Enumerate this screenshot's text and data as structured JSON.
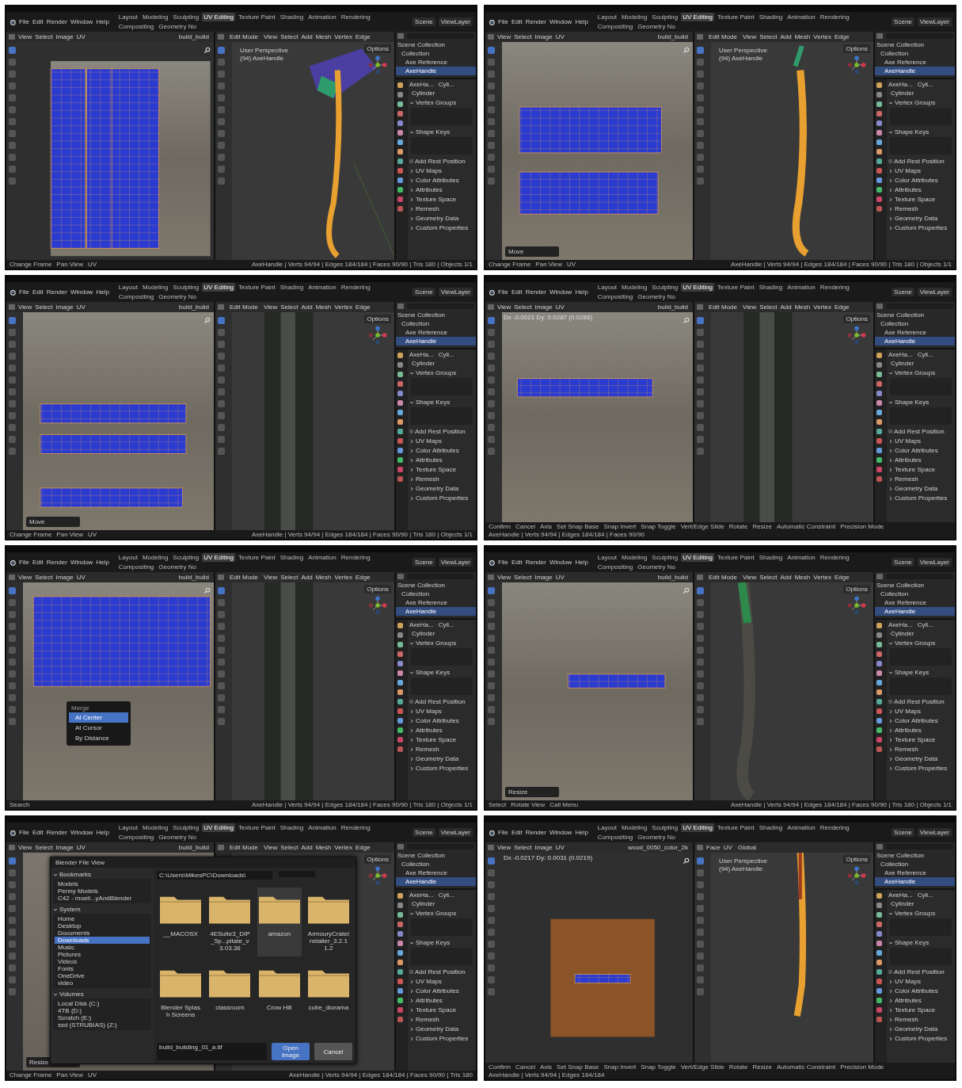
{
  "panels": [
    {
      "menus": [
        "File",
        "Edit",
        "Render",
        "Window",
        "Help"
      ],
      "workspaces": [
        {
          "label": "Layout",
          "selected": false
        },
        {
          "label": "Modeling",
          "selected": false
        },
        {
          "label": "Sculpting",
          "selected": false
        },
        {
          "label": "UV Editing",
          "selected": true
        },
        {
          "label": "Texture Paint",
          "selected": false
        },
        {
          "label": "Shading",
          "selected": false
        },
        {
          "label": "Animation",
          "selected": false
        },
        {
          "label": "Rendering",
          "selected": false
        },
        {
          "label": "Compositing",
          "selected": false
        },
        {
          "label": "Geometry No",
          "selected": false
        }
      ],
      "scene": "Scene",
      "view_layer": "ViewLayer",
      "uv_editor": {
        "menus": [
          "View",
          "Select",
          "Image",
          "UV"
        ],
        "image": "build_build",
        "kind": "vertical"
      },
      "viewport": {
        "mode": "Edit Mode",
        "menus": [
          "View",
          "Select",
          "Add",
          "Mesh",
          "Vertex",
          "Edge"
        ],
        "options": "Options",
        "overlay": [
          "User Perspective",
          "(94) AxeHandle"
        ],
        "kind": "axe"
      },
      "outliner": [
        {
          "label": "Scene Collection",
          "selected": false,
          "children": [
            {
              "label": "Collection",
              "selected": false,
              "children": [
                {
                  "label": "Axe Reference",
                  "selected": false
                },
                {
                  "label": "AxeHandle",
                  "selected": true
                }
              ]
            }
          ]
        }
      ],
      "properties": {
        "object": "AxeHa...",
        "mesh": "Cyli...",
        "data_name": "Cylinder",
        "sections": [
          {
            "kind": "panel",
            "label": "Vertex Groups",
            "expanded": true
          },
          {
            "kind": "panel",
            "label": "Shape Keys",
            "expanded": true
          },
          {
            "kind": "checkbox",
            "label": "Add Rest Position",
            "checked": false
          },
          {
            "kind": "panel",
            "label": "UV Maps",
            "expanded": false
          },
          {
            "kind": "panel",
            "label": "Color Attributes",
            "expanded": false
          },
          {
            "kind": "panel",
            "label": "Attributes",
            "expanded": false
          },
          {
            "kind": "panel",
            "label": "Texture Space",
            "expanded": false
          },
          {
            "kind": "panel",
            "label": "Remesh",
            "expanded": false
          },
          {
            "kind": "panel",
            "label": "Geometry Data",
            "expanded": false
          },
          {
            "kind": "panel",
            "label": "Custom Properties",
            "expanded": false
          }
        ]
      },
      "status": {
        "hints": [
          "Change Frame",
          "Pan View",
          "UV"
        ],
        "stats": "AxeHandle | Verts 94/94 | Edges 184/184 | Faces 90/90 | Tris 180 | Objects 1/1"
      }
    },
    {
      "menus": [
        "File",
        "Edit",
        "Render",
        "Window",
        "Help"
      ],
      "workspaces": [
        {
          "label": "Layout",
          "selected": false
        },
        {
          "label": "Modeling",
          "selected": false
        },
        {
          "label": "Sculpting",
          "selected": false
        },
        {
          "label": "UV Editing",
          "selected": true
        },
        {
          "label": "Texture Paint",
          "selected": false
        },
        {
          "label": "Shading",
          "selected": false
        },
        {
          "label": "Animation",
          "selected": false
        },
        {
          "label": "Rendering",
          "selected": false
        },
        {
          "label": "Compositing",
          "selected": false
        },
        {
          "label": "Geometry No",
          "selected": false
        }
      ],
      "scene": "Scene",
      "view_layer": "ViewLayer",
      "uv_editor": {
        "menus": [
          "View",
          "Select",
          "Image",
          "UV"
        ],
        "image": "build_build",
        "kind": "horizontal",
        "operator": "Move"
      },
      "viewport": {
        "mode": "Edit Mode",
        "menus": [
          "View",
          "Select",
          "Add",
          "Mesh",
          "Vertex",
          "Edge"
        ],
        "options": "Options",
        "overlay": [
          "User Perspective",
          "(94) AxeHandle"
        ],
        "kind": "handle"
      },
      "outliner": [
        {
          "label": "Scene Collection",
          "selected": false,
          "children": [
            {
              "label": "Collection",
              "selected": false,
              "children": [
                {
                  "label": "Axe Reference",
                  "selected": false
                },
                {
                  "label": "AxeHandle",
                  "selected": true
                }
              ]
            }
          ]
        }
      ],
      "properties": {
        "object": "AxeHa...",
        "mesh": "Cyli...",
        "data_name": "Cylinder",
        "sections": [
          {
            "kind": "panel",
            "label": "Vertex Groups",
            "expanded": true
          },
          {
            "kind": "panel",
            "label": "Shape Keys",
            "expanded": true
          },
          {
            "kind": "checkbox",
            "label": "Add Rest Position",
            "checked": false
          },
          {
            "kind": "panel",
            "label": "UV Maps",
            "expanded": false
          },
          {
            "kind": "panel",
            "label": "Color Attributes",
            "expanded": false
          },
          {
            "kind": "panel",
            "label": "Attributes",
            "expanded": false
          },
          {
            "kind": "panel",
            "label": "Texture Space",
            "expanded": false
          },
          {
            "kind": "panel",
            "label": "Remesh",
            "expanded": false
          },
          {
            "kind": "panel",
            "label": "Geometry Data",
            "expanded": false
          },
          {
            "kind": "panel",
            "label": "Custom Properties",
            "expanded": false
          }
        ]
      },
      "status": {
        "hints": [
          "Change Frame",
          "Pan View",
          "UV"
        ],
        "stats": "AxeHandle | Verts 94/94 | Edges 184/184 | Faces 90/90 | Tris 180 | Objects 1/1"
      }
    },
    {
      "menus": [
        "File",
        "Edit",
        "Render",
        "Window",
        "Help"
      ],
      "workspaces": [
        {
          "label": "Layout",
          "selected": false
        },
        {
          "label": "Modeling",
          "selected": false
        },
        {
          "label": "Sculpting",
          "selected": false
        },
        {
          "label": "UV Editing",
          "selected": true
        },
        {
          "label": "Texture Paint",
          "selected": false
        },
        {
          "label": "Shading",
          "selected": false
        },
        {
          "label": "Animation",
          "selected": false
        },
        {
          "label": "Rendering",
          "selected": false
        },
        {
          "label": "Compositing",
          "selected": false
        },
        {
          "label": "Geometry No",
          "selected": false
        }
      ],
      "scene": "Scene",
      "view_layer": "ViewLayer",
      "uv_editor": {
        "menus": [
          "View",
          "Select",
          "Image",
          "UV"
        ],
        "image": "build_build",
        "kind": "three-rows",
        "operator": "Move"
      },
      "viewport": {
        "mode": "Edit Mode",
        "menus": [
          "View",
          "Select",
          "Add",
          "Mesh",
          "Vertex",
          "Edge"
        ],
        "options": "Options",
        "kind": "closeup"
      },
      "outliner": [
        {
          "label": "Scene Collection",
          "selected": false,
          "children": [
            {
              "label": "Collection",
              "selected": false,
              "children": [
                {
                  "label": "Axe Reference",
                  "selected": false
                },
                {
                  "label": "AxeHandle",
                  "selected": true
                }
              ]
            }
          ]
        }
      ],
      "properties": {
        "object": "AxeHa...",
        "mesh": "Cyli...",
        "data_name": "Cylinder",
        "sections": [
          {
            "kind": "panel",
            "label": "Vertex Groups",
            "expanded": true
          },
          {
            "kind": "panel",
            "label": "Shape Keys",
            "expanded": true
          },
          {
            "kind": "checkbox",
            "label": "Add Rest Position",
            "checked": false
          },
          {
            "kind": "panel",
            "label": "UV Maps",
            "expanded": false
          },
          {
            "kind": "panel",
            "label": "Color Attributes",
            "expanded": false
          },
          {
            "kind": "panel",
            "label": "Attributes",
            "expanded": false
          },
          {
            "kind": "panel",
            "label": "Texture Space",
            "expanded": false
          },
          {
            "kind": "panel",
            "label": "Remesh",
            "expanded": false
          },
          {
            "kind": "panel",
            "label": "Geometry Data",
            "expanded": false
          },
          {
            "kind": "panel",
            "label": "Custom Properties",
            "expanded": false
          }
        ]
      },
      "status": {
        "hints": [
          "Change Frame",
          "Pan View",
          "UV"
        ],
        "stats": "AxeHandle | Verts 94/94 | Edges 184/184 | Faces 90/90 | Tris 180 | Objects 1/1"
      }
    },
    {
      "menus": [
        "File",
        "Edit",
        "Render",
        "Window",
        "Help"
      ],
      "workspaces": [
        {
          "label": "Layout",
          "selected": false
        },
        {
          "label": "Modeling",
          "selected": false
        },
        {
          "label": "Sculpting",
          "selected": false
        },
        {
          "label": "UV Editing",
          "selected": true
        },
        {
          "label": "Texture Paint",
          "selected": false
        },
        {
          "label": "Shading",
          "selected": false
        },
        {
          "label": "Animation",
          "selected": false
        },
        {
          "label": "Rendering",
          "selected": false
        },
        {
          "label": "Compositing",
          "selected": false
        },
        {
          "label": "Geometry No",
          "selected": false
        }
      ],
      "scene": "Scene",
      "view_layer": "ViewLayer",
      "uv_editor": {
        "menus": [
          "View",
          "Select",
          "Image",
          "UV"
        ],
        "image": "build_build",
        "kind": "thin-row",
        "delta": "Dx -0.0021  Dy: 0.0287 (0.0288)"
      },
      "viewport": {
        "mode": "Edit Mode",
        "menus": [
          "View",
          "Select",
          "Add",
          "Mesh",
          "Vertex",
          "Edge"
        ],
        "options": "Options",
        "kind": "closeup"
      },
      "outliner": [
        {
          "label": "Scene Collection",
          "selected": false,
          "children": [
            {
              "label": "Collection",
              "selected": false,
              "children": [
                {
                  "label": "Axe Reference",
                  "selected": false
                },
                {
                  "label": "AxeHandle",
                  "selected": true
                }
              ]
            }
          ]
        }
      ],
      "properties": {
        "object": "AxeHa...",
        "mesh": "Cyli...",
        "data_name": "Cylinder",
        "sections": [
          {
            "kind": "panel",
            "label": "Vertex Groups",
            "expanded": true
          },
          {
            "kind": "panel",
            "label": "Shape Keys",
            "expanded": true
          },
          {
            "kind": "checkbox",
            "label": "Add Rest Position",
            "checked": false
          },
          {
            "kind": "panel",
            "label": "UV Maps",
            "expanded": false
          },
          {
            "kind": "panel",
            "label": "Color Attributes",
            "expanded": false
          },
          {
            "kind": "panel",
            "label": "Attributes",
            "expanded": false
          },
          {
            "kind": "panel",
            "label": "Texture Space",
            "expanded": false
          },
          {
            "kind": "panel",
            "label": "Remesh",
            "expanded": false
          },
          {
            "kind": "panel",
            "label": "Geometry Data",
            "expanded": false
          },
          {
            "kind": "panel",
            "label": "Custom Properties",
            "expanded": false
          }
        ]
      },
      "status": {
        "hints": [
          "Confirm",
          "Cancel",
          "Axis",
          "Set Snap Base",
          "Snap Invert",
          "Snap Toggle",
          "Vert/Edge Slide",
          "Rotate",
          "Resize",
          "Automatic Constraint",
          "Precision Mode"
        ],
        "stats": "AxeHandle | Verts 94/94 | Edges 184/184 | Faces 90/90"
      }
    },
    {
      "menus": [
        "File",
        "Edit",
        "Render",
        "Window",
        "Help"
      ],
      "workspaces": [
        {
          "label": "Layout",
          "selected": false
        },
        {
          "label": "Modeling",
          "selected": false
        },
        {
          "label": "Sculpting",
          "selected": false
        },
        {
          "label": "UV Editing",
          "selected": true
        },
        {
          "label": "Texture Paint",
          "selected": false
        },
        {
          "label": "Shading",
          "selected": false
        },
        {
          "label": "Animation",
          "selected": false
        },
        {
          "label": "Rendering",
          "selected": false
        },
        {
          "label": "Compositing",
          "selected": false
        },
        {
          "label": "Geometry No",
          "selected": false
        }
      ],
      "scene": "Scene",
      "view_layer": "ViewLayer",
      "uv_editor": {
        "menus": [
          "View",
          "Select",
          "Image",
          "UV"
        ],
        "image": "build_build",
        "kind": "zoomed",
        "popup": {
          "title": "Merge",
          "items": [
            {
              "label": "At Center",
              "selected": true
            },
            {
              "label": "At Cursor",
              "selected": false
            },
            {
              "label": "By Distance",
              "selected": false
            }
          ]
        }
      },
      "viewport": {
        "mode": "Edit Mode",
        "menus": [
          "View",
          "Select",
          "Add",
          "Mesh",
          "Vertex",
          "Edge"
        ],
        "options": "Options",
        "kind": "closeup"
      },
      "outliner": [
        {
          "label": "Scene Collection",
          "selected": false,
          "children": [
            {
              "label": "Collection",
              "selected": false,
              "children": [
                {
                  "label": "Axe Reference",
                  "selected": false
                },
                {
                  "label": "AxeHandle",
                  "selected": true
                }
              ]
            }
          ]
        }
      ],
      "properties": {
        "object": "AxeHa...",
        "mesh": "Cyli...",
        "data_name": "Cylinder",
        "sections": [
          {
            "kind": "panel",
            "label": "Vertex Groups",
            "expanded": true
          },
          {
            "kind": "panel",
            "label": "Shape Keys",
            "expanded": true
          },
          {
            "kind": "checkbox",
            "label": "Add Rest Position",
            "checked": false
          },
          {
            "kind": "panel",
            "label": "UV Maps",
            "expanded": false
          },
          {
            "kind": "panel",
            "label": "Color Attributes",
            "expanded": false
          },
          {
            "kind": "panel",
            "label": "Attributes",
            "expanded": false
          },
          {
            "kind": "panel",
            "label": "Texture Space",
            "expanded": false
          },
          {
            "kind": "panel",
            "label": "Remesh",
            "expanded": false
          },
          {
            "kind": "panel",
            "label": "Geometry Data",
            "expanded": false
          },
          {
            "kind": "panel",
            "label": "Custom Properties",
            "expanded": false
          }
        ]
      },
      "status": {
        "hints": [
          "Search"
        ],
        "stats": "AxeHandle | Verts 94/94 | Edges 184/184 | Faces 90/90 | Tris 180 | Objects 1/1"
      }
    },
    {
      "menus": [
        "File",
        "Edit",
        "Render",
        "Window",
        "Help"
      ],
      "workspaces": [
        {
          "label": "Layout",
          "selected": false
        },
        {
          "label": "Modeling",
          "selected": false
        },
        {
          "label": "Sculpting",
          "selected": false
        },
        {
          "label": "UV Editing",
          "selected": true
        },
        {
          "label": "Texture Paint",
          "selected": false
        },
        {
          "label": "Shading",
          "selected": false
        },
        {
          "label": "Animation",
          "selected": false
        },
        {
          "label": "Rendering",
          "selected": false
        },
        {
          "label": "Compositing",
          "selected": false
        },
        {
          "label": "Geometry No",
          "selected": false
        }
      ],
      "scene": "Scene",
      "view_layer": "ViewLayer",
      "uv_editor": {
        "menus": [
          "View",
          "Select",
          "Image",
          "UV"
        ],
        "image": "build_build",
        "kind": "thin-center",
        "operator": "Resize"
      },
      "viewport": {
        "mode": "Edit Mode",
        "menus": [
          "View",
          "Select",
          "Add",
          "Mesh",
          "Vertex",
          "Edge"
        ],
        "options": "Options",
        "kind": "dark-handle"
      },
      "outliner": [
        {
          "label": "Scene Collection",
          "selected": false,
          "children": [
            {
              "label": "Collection",
              "selected": false,
              "children": [
                {
                  "label": "Axe Reference",
                  "selected": false
                },
                {
                  "label": "AxeHandle",
                  "selected": true
                }
              ]
            }
          ]
        }
      ],
      "properties": {
        "object": "AxeHa...",
        "mesh": "Cyli...",
        "data_name": "Cylinder",
        "sections": [
          {
            "kind": "panel",
            "label": "Vertex Groups",
            "expanded": true
          },
          {
            "kind": "panel",
            "label": "Shape Keys",
            "expanded": true
          },
          {
            "kind": "checkbox",
            "label": "Add Rest Position",
            "checked": false
          },
          {
            "kind": "panel",
            "label": "UV Maps",
            "expanded": false
          },
          {
            "kind": "panel",
            "label": "Color Attributes",
            "expanded": false
          },
          {
            "kind": "panel",
            "label": "Attributes",
            "expanded": false
          },
          {
            "kind": "panel",
            "label": "Texture Space",
            "expanded": false
          },
          {
            "kind": "panel",
            "label": "Remesh",
            "expanded": false
          },
          {
            "kind": "panel",
            "label": "Geometry Data",
            "expanded": false
          },
          {
            "kind": "panel",
            "label": "Custom Properties",
            "expanded": false
          }
        ]
      },
      "status": {
        "hints": [
          "Select",
          "Rotate View",
          "Call Menu"
        ],
        "stats": "AxeHandle | Verts 94/94 | Edges 184/184 | Faces 90/90 | Tris 180 | Objects 1/1"
      }
    },
    {
      "menus": [
        "File",
        "Edit",
        "Render",
        "Window",
        "Help"
      ],
      "workspaces": [
        {
          "label": "Layout",
          "selected": false
        },
        {
          "label": "Modeling",
          "selected": false
        },
        {
          "label": "Sculpting",
          "selected": false
        },
        {
          "label": "UV Editing",
          "selected": true
        },
        {
          "label": "Texture Paint",
          "selected": false
        },
        {
          "label": "Shading",
          "selected": false
        },
        {
          "label": "Animation",
          "selected": false
        },
        {
          "label": "Rendering",
          "selected": false
        },
        {
          "label": "Compositing",
          "selected": false
        },
        {
          "label": "Geometry No",
          "selected": false
        }
      ],
      "scene": "Scene",
      "view_layer": "ViewLayer",
      "uv_editor": {
        "menus": [
          "View",
          "Select",
          "Image",
          "UV"
        ],
        "image": "build_build",
        "kind": "plain",
        "operator": "Resize"
      },
      "viewport": {
        "mode": "Edit Mode",
        "menus": [
          "View",
          "Select",
          "Add",
          "Mesh",
          "Vertex",
          "Edge"
        ],
        "options": "Options",
        "kind": "none"
      },
      "outliner": [
        {
          "label": "Scene Collection",
          "selected": false,
          "children": [
            {
              "label": "Collection",
              "selected": false,
              "children": [
                {
                  "label": "Axe Reference",
                  "selected": false
                },
                {
                  "label": "AxeHandle",
                  "selected": true
                }
              ]
            }
          ]
        }
      ],
      "properties": {
        "object": "AxeHa...",
        "mesh": "Cyli...",
        "data_name": "Cylinder",
        "sections": [
          {
            "kind": "panel",
            "label": "Vertex Groups",
            "expanded": true
          },
          {
            "kind": "panel",
            "label": "Shape Keys",
            "expanded": true
          },
          {
            "kind": "checkbox",
            "label": "Add Rest Position",
            "checked": false
          },
          {
            "kind": "panel",
            "label": "UV Maps",
            "expanded": false
          },
          {
            "kind": "panel",
            "label": "Color Attributes",
            "expanded": false
          },
          {
            "kind": "panel",
            "label": "Attributes",
            "expanded": false
          },
          {
            "kind": "panel",
            "label": "Texture Space",
            "expanded": false
          },
          {
            "kind": "panel",
            "label": "Remesh",
            "expanded": false
          },
          {
            "kind": "panel",
            "label": "Geometry Data",
            "expanded": false
          },
          {
            "kind": "panel",
            "label": "Custom Properties",
            "expanded": false
          }
        ]
      },
      "status": {
        "hints": [
          "Change Frame",
          "Pan View",
          "UV"
        ],
        "stats": "AxeHandle | Verts 94/94 | Edges 184/184 | Faces 90/90 | Tris 180"
      },
      "file_dialog": {
        "title": "Blender File View",
        "path": "C:\\Users\\MikesPC\\Downloads\\",
        "groups": [
          {
            "label": "Bookmarks",
            "expanded": true,
            "items": [
              {
                "label": "Models",
                "selected": false
              },
              {
                "label": "Penny Models",
                "selected": false
              },
              {
                "label": "C42 - moeil...yAndBlender",
                "selected": false
              }
            ]
          },
          {
            "label": "System",
            "expanded": true,
            "items": [
              {
                "label": "Home",
                "selected": false
              },
              {
                "label": "Desktop",
                "selected": false
              },
              {
                "label": "Documents",
                "selected": false
              },
              {
                "label": "Downloads",
                "selected": true
              },
              {
                "label": "Music",
                "selected": false
              },
              {
                "label": "Pictures",
                "selected": false
              },
              {
                "label": "Videos",
                "selected": false
              },
              {
                "label": "Fonts",
                "selected": false
              },
              {
                "label": "OneDrive",
                "selected": false
              },
              {
                "label": "video",
                "selected": false
              }
            ]
          },
          {
            "label": "Volumes",
            "expanded": true,
            "items": [
              {
                "label": "Local Disk (C:)",
                "selected": false
              },
              {
                "label": "4TB (D:)",
                "selected": false
              },
              {
                "label": "Scratch (E:)",
                "selected": false
              },
              {
                "label": "ssd (STRUBIAS) (Z:)",
                "selected": false
              }
            ]
          }
        ],
        "folders": [
          {
            "label": "__MACOSX",
            "selected": false
          },
          {
            "label": "4ESuite3_DIP_5p...pitate_v3.03.36",
            "selected": false
          },
          {
            "label": "amazon",
            "selected": true
          },
          {
            "label": "ArmouryCrateInstaller_3.2.11.2",
            "selected": false
          },
          {
            "label": "Blender Splash Screens",
            "selected": false
          },
          {
            "label": "classroom",
            "selected": false
          },
          {
            "label": "Crow Hill",
            "selected": false
          },
          {
            "label": "cube_diorama",
            "selected": false
          }
        ],
        "filename": "build_building_01_a.tif",
        "confirm": "Open Image",
        "cancel": "Cancel"
      }
    },
    {
      "menus": [
        "File",
        "Edit",
        "Render",
        "Window",
        "Help"
      ],
      "workspaces": [
        {
          "label": "Layout",
          "selected": false
        },
        {
          "label": "Modeling",
          "selected": false
        },
        {
          "label": "Sculpting",
          "selected": false
        },
        {
          "label": "UV Editing",
          "selected": true
        },
        {
          "label": "Texture Paint",
          "selected": false
        },
        {
          "label": "Shading",
          "selected": false
        },
        {
          "label": "Animation",
          "selected": false
        },
        {
          "label": "Rendering",
          "selected": false
        },
        {
          "label": "Compositing",
          "selected": false
        },
        {
          "label": "Geometry No",
          "selected": false
        }
      ],
      "scene": "Scene",
      "view_layer": "ViewLayer",
      "uv_editor": {
        "menus": [
          "View",
          "Select",
          "Image",
          "UV"
        ],
        "image": "wood_0050_color_2k",
        "kind": "wood",
        "delta": "Dx -0.0217  Dy: 0.0031 (0.0219)"
      },
      "viewport": {
        "menus": [
          "Face",
          "UV"
        ],
        "transform": "Global",
        "options": "Options",
        "overlay": [
          "User Perspective",
          "(94) AxeHandle"
        ],
        "kind": "handle-selected"
      },
      "outliner": [
        {
          "label": "Scene Collection",
          "selected": false,
          "children": [
            {
              "label": "Collection",
              "selected": false,
              "children": [
                {
                  "label": "Axe Reference",
                  "selected": false
                },
                {
                  "label": "AxeHandle",
                  "selected": true
                }
              ]
            }
          ]
        }
      ],
      "properties": {
        "object": "AxeHa...",
        "mesh": "Cyli...",
        "data_name": "Cylinder",
        "sections": [
          {
            "kind": "panel",
            "label": "Vertex Groups",
            "expanded": true
          },
          {
            "kind": "panel",
            "label": "Shape Keys",
            "expanded": true
          },
          {
            "kind": "checkbox",
            "label": "Add Rest Position",
            "checked": false
          },
          {
            "kind": "panel",
            "label": "UV Maps",
            "expanded": false
          },
          {
            "kind": "panel",
            "label": "Color Attributes",
            "expanded": false
          },
          {
            "kind": "panel",
            "label": "Attributes",
            "expanded": false
          },
          {
            "kind": "panel",
            "label": "Texture Space",
            "expanded": false
          },
          {
            "kind": "panel",
            "label": "Remesh",
            "expanded": false
          },
          {
            "kind": "panel",
            "label": "Geometry Data",
            "expanded": false
          },
          {
            "kind": "panel",
            "label": "Custom Properties",
            "expanded": false
          }
        ]
      },
      "status": {
        "hints": [
          "Confirm",
          "Cancel",
          "Axis",
          "Set Snap Base",
          "Snap Invert",
          "Snap Toggle",
          "Vert/Edge Slide",
          "Rotate",
          "Resize",
          "Automatic Constraint",
          "Precision Mode"
        ],
        "stats": "AxeHandle | Verts 94/94 | Edges 184/184"
      }
    }
  ]
}
